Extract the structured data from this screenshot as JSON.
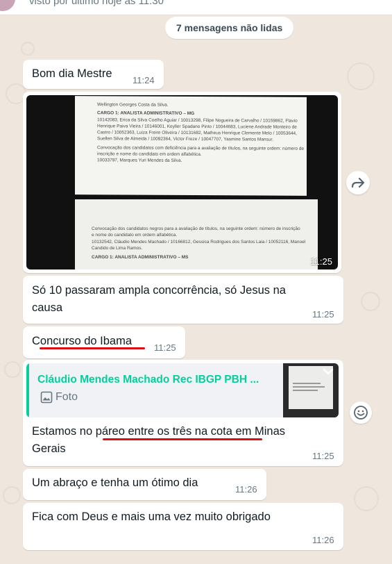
{
  "header": {
    "status": "visto por último hoje às 11:30"
  },
  "unread_banner": "7 mensagens não lidas",
  "messages": [
    {
      "text": "Bom dia Mestre",
      "time": "11:24"
    },
    {
      "type": "image",
      "time": "11:25",
      "doc_lines_top": [
        "Wellington Georges Costa da Silva.",
        "CARGO 1: ANALISTA ADMINISTRATIVO – MG",
        "10142083, Erica da Silva Coelho Aguiar / 10013298, Filipe Nogueira de Carvalho / 10159862, Flavio",
        "Henrique Paiva Vieira / 10146001, Keyller Spadano Pinto / 10044683, Luciene Andrade Monteiro de",
        "Castro / 10052363, Luiza Freire Oliveira / 10131682, Matheus Henrique Clemente Melo / 10053644,",
        "Suellen Silva de Almeida / 10092364, Victor Freze / 10047707, Yasmine Santos Mansur.",
        "Convocação dos candidatos com deficiência para a avaliação de títulos, na seguinte ordem: número de",
        "inscrição e nome do candidato em ordem alfabética.",
        "10033797, Marques Yuri Mendes da Silva."
      ],
      "doc_lines_bottom": [
        "Convocação dos candidatos negros para a avaliação de títulos, na seguinte ordem: número de inscrição",
        "e nome do candidato em ordem alfabética.",
        "10132542, Cláudio Mendes Machado / 10166812, Gessica Rodrigues dos Santos Laia / 10052116, Manoel",
        "Candido de Lima Ramos.",
        "CARGO 1: ANALISTA ADMINISTRATIVO – MS"
      ]
    },
    {
      "text_line1": "Só 10 passaram ampla concorrência, só Jesus na",
      "text_line2": "causa",
      "time": "11:25"
    },
    {
      "text": "Concurso do Ibama",
      "time": "11:25"
    },
    {
      "type": "reply",
      "quote_author": "Cláudio Mendes Machado Rec IBGP PBH ...",
      "quote_type": "Foto",
      "text_line1": "Estamos no páreo entre os três na cota em Minas",
      "text_line2": "Gerais",
      "time": "11:25"
    },
    {
      "text": "Um abraço e tenha um ótimo dia",
      "time": "11:26"
    },
    {
      "text": "Fica com Deus e mais uma vez muito obrigado",
      "time": "11:26"
    }
  ],
  "icons": {
    "forward": "forward-icon",
    "emoji": "emoji-reaction-icon",
    "photo": "photo-icon",
    "chevron": "chevron-down-icon"
  },
  "colors": {
    "wallpaper": "#efe7dd",
    "bubble": "#ffffff",
    "accent": "#06cf9c",
    "annotation": "#d80f16"
  }
}
